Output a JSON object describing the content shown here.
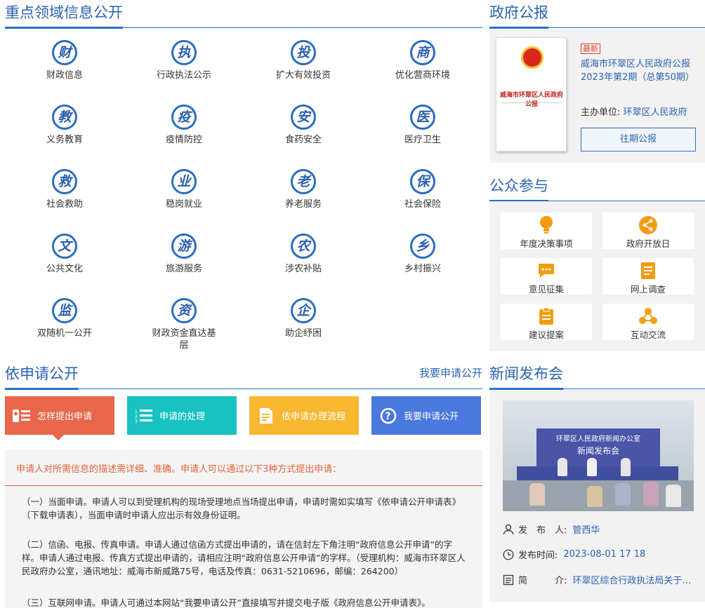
{
  "key_domains": {
    "title": "重点领域信息公开",
    "items": [
      {
        "char": "财",
        "label": "财政信息"
      },
      {
        "char": "执",
        "label": "行政执法公示"
      },
      {
        "char": "投",
        "label": "扩大有效投资"
      },
      {
        "char": "商",
        "label": "优化营商环境"
      },
      {
        "char": "教",
        "label": "义务教育"
      },
      {
        "char": "疫",
        "label": "疫情防控"
      },
      {
        "char": "安",
        "label": "食药安全"
      },
      {
        "char": "医",
        "label": "医疗卫生"
      },
      {
        "char": "救",
        "label": "社会救助"
      },
      {
        "char": "业",
        "label": "稳岗就业"
      },
      {
        "char": "老",
        "label": "养老服务"
      },
      {
        "char": "保",
        "label": "社会保险"
      },
      {
        "char": "文",
        "label": "公共文化"
      },
      {
        "char": "游",
        "label": "旅游服务"
      },
      {
        "char": "农",
        "label": "涉农补贴"
      },
      {
        "char": "乡",
        "label": "乡村振兴"
      },
      {
        "char": "监",
        "label": "双随机一公开"
      },
      {
        "char": "资",
        "label": "财政资金直达基层"
      },
      {
        "char": "企",
        "label": "助企纾困"
      }
    ]
  },
  "apply": {
    "title": "依申请公开",
    "link": "我要申请公开",
    "tabs": [
      {
        "label": "怎样提出申请",
        "color": "#e8664a"
      },
      {
        "label": "申请的处理",
        "color": "#17c2c0"
      },
      {
        "label": "依申请办理流程",
        "color": "#f7b731"
      },
      {
        "label": "我要申请公开",
        "color": "#4a78de"
      }
    ],
    "intro": "申请人对所需信息的描述需详细、准确。申请人可以通过以下3种方式提出申请：",
    "paragraphs": [
      "（一）当面申请。申请人可以到受理机构的现场受理地点当场提出申请，申请时需如实填写《依申请公开申请表》（下载申请表），当面申请时申请人应出示有效身份证明。",
      "（二）信函、电报、传真申请。申请人通过信函方式提出申请的，请在信封左下角注明“政府信息公开申请”的字样。申请人通过电报、传真方式提出申请的，请相应注明“政府信息公开申请”的字样。（受理机构：威海市环翠区人民政府办公室，通讯地址：威海市新威路75号，电话及传真：0631-5210696，邮编：264200）",
      "（三）互联网申请。申请人可通过本网站“我要申请公开”直接填写并提交电子版《政府信息公开申请表》。"
    ]
  },
  "gazette": {
    "title": "政府公报",
    "badge": "最新",
    "issue": "威海市环翠区人民政府公报2023年第2期（总第50期）",
    "cover_title": "威海市环翠区人民政府公报",
    "host_label": "主办单位:",
    "host": "环翠区人民政府",
    "button": "往期公报"
  },
  "public": {
    "title": "公众参与",
    "items": [
      {
        "label": "年度决策事项",
        "icon": "bulb-icon"
      },
      {
        "label": "政府开放日",
        "icon": "share-icon"
      },
      {
        "label": "意见征集",
        "icon": "comment-icon"
      },
      {
        "label": "网上调查",
        "icon": "survey-icon"
      },
      {
        "label": "建议提案",
        "icon": "clipboard-icon"
      },
      {
        "label": "互动交流",
        "icon": "network-icon"
      }
    ]
  },
  "news": {
    "title": "新闻发布会",
    "banner_line1": "环翠区人民政府新闻办公室",
    "banner_line2": "新闻发布会",
    "publisher_label": "发　布　人:",
    "publisher": "管西华",
    "time_label": "发布时间:",
    "time": "2023-08-01 17 18",
    "summary_label": "简　　　介:",
    "summary": "环翠区综合行政执法局关于季..."
  },
  "colors": {
    "primary": "#2a63b2",
    "accent": "#e8664a",
    "orange": "#f39c12"
  }
}
